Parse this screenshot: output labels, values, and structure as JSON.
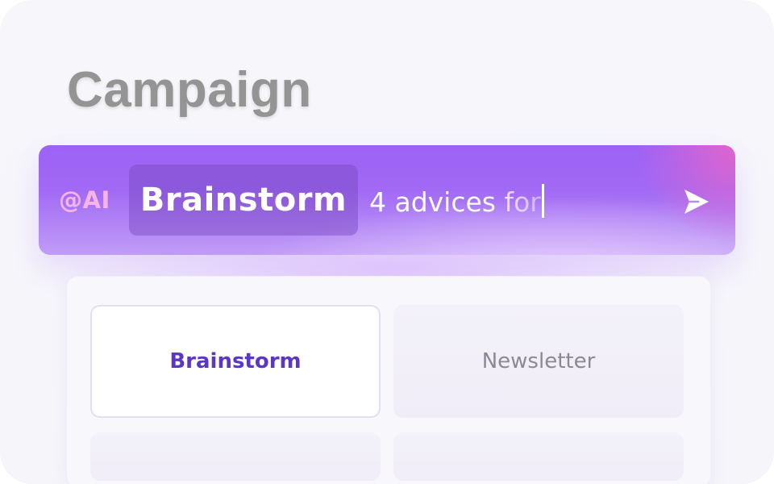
{
  "header": {
    "title": "Campaign"
  },
  "ai_bar": {
    "tag": "@AI",
    "command_chip": "Brainstorm",
    "prompt_value": "4 advices for ",
    "send_icon": "send-icon",
    "colors": {
      "bar_start": "#9c62f5",
      "bar_end": "#c09cf6",
      "corner_accent": "#e864c8",
      "tag": "#f6b4e8"
    }
  },
  "suggestions": {
    "items": [
      {
        "label": "Brainstorm",
        "selected": true
      },
      {
        "label": "Newsletter",
        "selected": false
      },
      {
        "label": "",
        "selected": false
      },
      {
        "label": "",
        "selected": false
      }
    ],
    "selected_color": "#5c36c4"
  }
}
